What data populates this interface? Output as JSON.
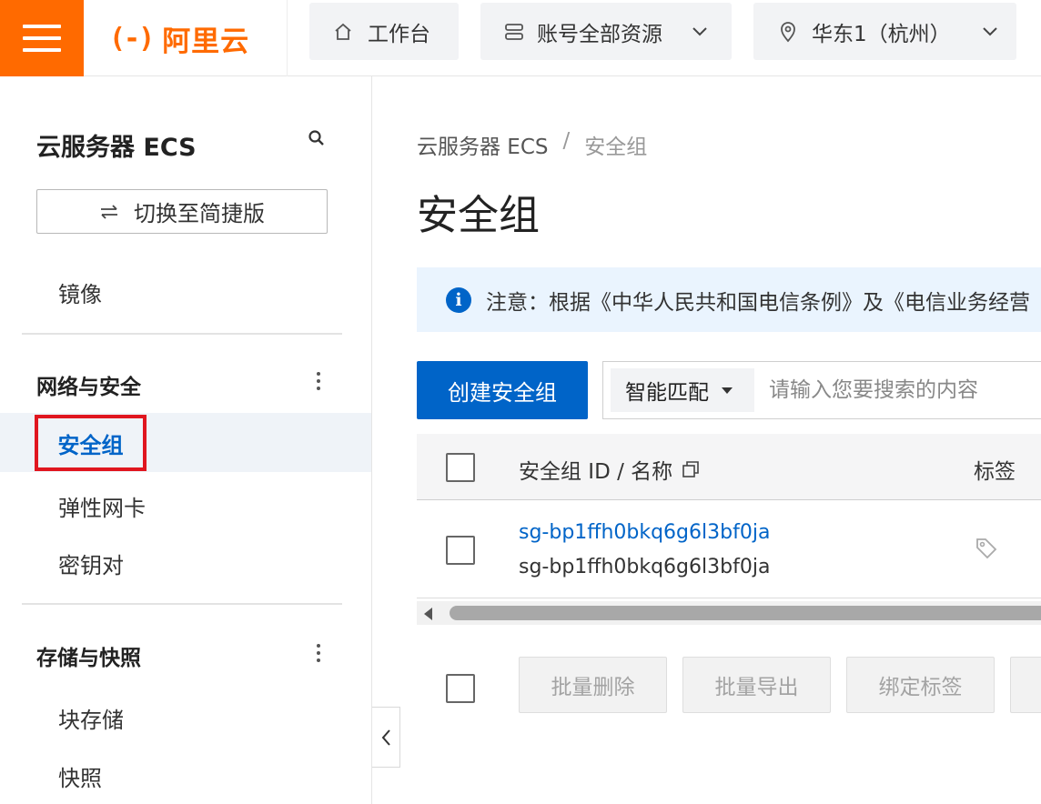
{
  "topbar": {
    "logo_mark": "(-)",
    "logo_text": "阿里云",
    "workbench": "工作台",
    "account_resources": "账号全部资源",
    "region": "华东1（杭州）"
  },
  "sidebar": {
    "title": "云服务器 ECS",
    "switch_label": "切换至简捷版",
    "item_image": "镜像",
    "group_network": "网络与安全",
    "item_security_group": "安全组",
    "item_eni": "弹性网卡",
    "item_keypair": "密钥对",
    "group_storage": "存储与快照",
    "item_block_storage": "块存储",
    "item_snapshot": "快照"
  },
  "main": {
    "breadcrumb": {
      "root": "云服务器 ECS",
      "sep": "/",
      "current": "安全组"
    },
    "page_title": "安全组",
    "notice": "注意：根据《中华人民共和国电信条例》及《电信业务经营",
    "create_label": "创建安全组",
    "search": {
      "mode": "智能匹配",
      "placeholder": "请输入您要搜索的内容"
    },
    "table": {
      "col_id": "安全组 ID / 名称",
      "col_tag": "标签",
      "rows": [
        {
          "id": "sg-bp1ffh0bkq6g6l3bf0ja",
          "name": "sg-bp1ffh0bkq6g6l3bf0ja"
        }
      ]
    },
    "batch": {
      "delete": "批量删除",
      "export": "批量导出",
      "bind_tag": "绑定标签"
    }
  },
  "colors": {
    "brand_orange": "#ff6a00",
    "primary_blue": "#0064c8",
    "highlight_red": "#e0161f",
    "notice_bg": "#eaf4fe"
  }
}
